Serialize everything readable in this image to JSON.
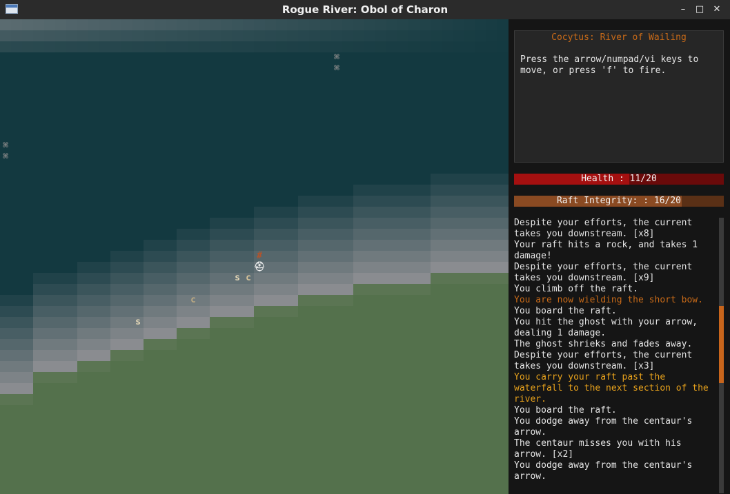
{
  "window": {
    "title": "Rogue River: Obol of Charon",
    "minimize": "–",
    "maximize": "□",
    "close": "✕"
  },
  "colors": {
    "water_dark": "#143a40",
    "shore": "#8a8c90",
    "grass": "#54714c",
    "health_fill": "#a51010",
    "health_bg": "#6a0a0a",
    "raft_fill": "#8a4a22",
    "raft_bg": "#5a3016",
    "log_orange": "#c86a18",
    "log_yellow": "#e8a21c"
  },
  "map": {
    "glyphs": [
      {
        "name": "rock-icon",
        "char": "⌘",
        "color": "#8a8a8a",
        "col": 30,
        "row": 3
      },
      {
        "name": "rock-icon",
        "char": "⌘",
        "color": "#8a8a8a",
        "col": 30,
        "row": 4
      },
      {
        "name": "rock-icon",
        "char": "⌘",
        "color": "#8a8a8a",
        "col": 0,
        "row": 11
      },
      {
        "name": "rock-icon",
        "char": "⌘",
        "color": "#8a8a8a",
        "col": 0,
        "row": 12
      },
      {
        "name": "raft-icon",
        "char": "#",
        "color": "#b5532a",
        "col": 23,
        "row": 21
      },
      {
        "name": "player-helmet-icon",
        "char": "⛑",
        "color": "#f2f2f2",
        "col": 23,
        "row": 22
      },
      {
        "name": "skeleton-enemy",
        "char": "s",
        "color": "#e6d9b8",
        "col": 21,
        "row": 23
      },
      {
        "name": "centaur-enemy",
        "char": "c",
        "color": "#d8c49a",
        "col": 22,
        "row": 23
      },
      {
        "name": "centaur-enemy",
        "char": "c",
        "color": "#bba983",
        "col": 17,
        "row": 25
      },
      {
        "name": "skeleton-enemy",
        "char": "s",
        "color": "#e6d9b8",
        "col": 12,
        "row": 27
      }
    ]
  },
  "sidebar": {
    "level_name": "Cocytus: River of Wailing",
    "help_text": "Press the arrow/numpad/vi keys to move, or press 'f' to fire.",
    "health": {
      "label": "Health : 11/20",
      "value": 11,
      "max": 20
    },
    "raft": {
      "label": "Raft Integrity: : 16/20",
      "value": 16,
      "max": 20
    },
    "log": [
      {
        "text": "Despite your efforts, the current takes you downstream. [x8]",
        "color": "#e6e6e6"
      },
      {
        "text": "Your raft hits a rock, and takes 1 damage!",
        "color": "#e6e6e6"
      },
      {
        "text": "Despite your efforts, the current takes you downstream. [x9]",
        "color": "#e6e6e6"
      },
      {
        "text": "You climb off the raft.",
        "color": "#e6e6e6"
      },
      {
        "text": "You are now wielding the short bow.",
        "color": "#c86a18"
      },
      {
        "text": "You board the raft.",
        "color": "#e6e6e6"
      },
      {
        "text": "You hit the ghost with your arrow, dealing 1 damage.",
        "color": "#e6e6e6"
      },
      {
        "text": "The ghost shrieks and fades away.",
        "color": "#e6e6e6"
      },
      {
        "text": "Despite your efforts, the current takes you downstream. [x3]",
        "color": "#e6e6e6"
      },
      {
        "text": "You carry your raft past the waterfall to the next section of the river.",
        "color": "#e8a21c"
      },
      {
        "text": "You board the raft.",
        "color": "#e6e6e6"
      },
      {
        "text": "You dodge away from the centaur's arrow.",
        "color": "#e6e6e6"
      },
      {
        "text": "The centaur misses you with his arrow. [x2]",
        "color": "#e6e6e6"
      },
      {
        "text": "You dodge away from the centaur's arrow.",
        "color": "#e6e6e6"
      }
    ]
  }
}
